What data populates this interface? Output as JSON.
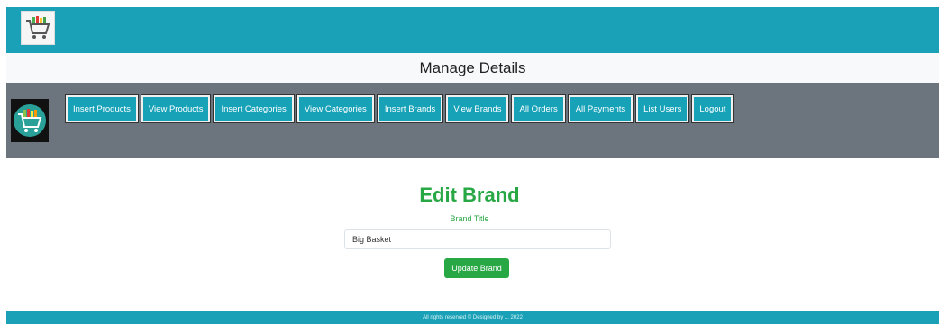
{
  "header": {
    "logo_icon": "shopping-cart-groceries-icon",
    "bg_color": "#1ba1b7"
  },
  "title_band": {
    "title": "Manage Details"
  },
  "navbar": {
    "admin_image_icon": "shopping-cart-groceries-icon",
    "bg_color": "#6c757d",
    "buttons": [
      {
        "label": "Insert Products"
      },
      {
        "label": "View Products"
      },
      {
        "label": "Insert Categories"
      },
      {
        "label": "View Categories"
      },
      {
        "label": "Insert Brands"
      },
      {
        "label": "View Brands"
      },
      {
        "label": "All Orders"
      },
      {
        "label": "All Payments"
      },
      {
        "label": "List Users"
      },
      {
        "label": "Logout"
      }
    ]
  },
  "form": {
    "heading": "Edit Brand",
    "field_label": "Brand Title",
    "brand_value": "Big Basket",
    "submit_label": "Update Brand",
    "accent_color": "#28a745"
  },
  "footer": {
    "text": "All rights reserved © Designed by ... 2022",
    "bg_color": "#1ba1b7"
  }
}
